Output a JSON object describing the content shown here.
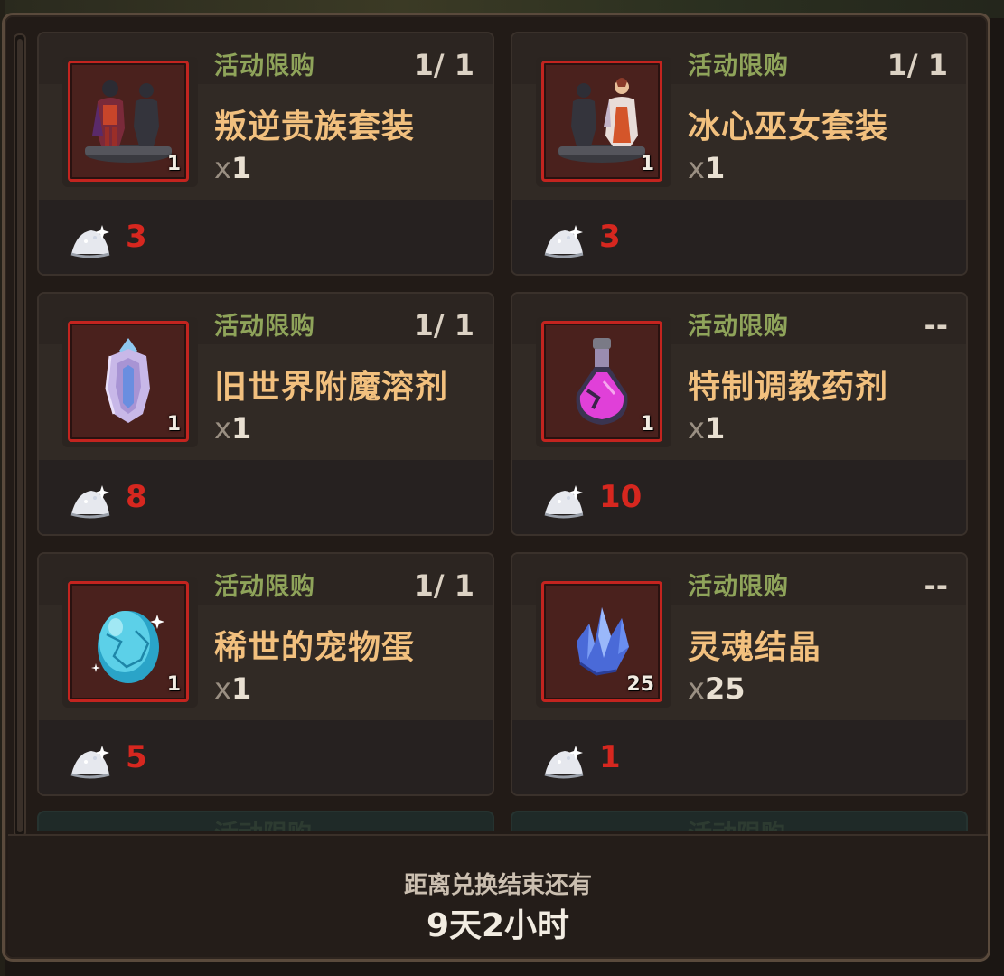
{
  "shop": {
    "items": [
      {
        "tag": "活动限购",
        "limit": "1/ 1",
        "name": "叛逆贵族套装",
        "qty_x": "x",
        "qty": "1",
        "icon_count": "1",
        "icon": "rebel-noble-outfit-icon",
        "price": "3"
      },
      {
        "tag": "活动限购",
        "limit": "1/ 1",
        "name": "冰心巫女套装",
        "qty_x": "x",
        "qty": "1",
        "icon_count": "1",
        "icon": "ice-heart-witch-outfit-icon",
        "price": "3"
      },
      {
        "tag": "活动限购",
        "limit": "1/ 1",
        "name": "旧世界附魔溶剂",
        "qty_x": "x",
        "qty": "1",
        "icon_count": "1",
        "icon": "enchant-solvent-icon",
        "price": "8"
      },
      {
        "tag": "活动限购",
        "limit": "--",
        "name": "特制调教药剂",
        "qty_x": "x",
        "qty": "1",
        "icon_count": "1",
        "icon": "potion-flask-icon",
        "price": "10"
      },
      {
        "tag": "活动限购",
        "limit": "1/ 1",
        "name": "稀世的宠物蛋",
        "qty_x": "x",
        "qty": "1",
        "icon_count": "1",
        "icon": "pet-egg-icon",
        "price": "5"
      },
      {
        "tag": "活动限购",
        "limit": "--",
        "name": "灵魂结晶",
        "qty_x": "x",
        "qty": "25",
        "icon_count": "25",
        "icon": "soul-crystal-icon",
        "price": "1"
      }
    ],
    "peek": [
      {
        "tag": "活动限购"
      },
      {
        "tag": "活动限购"
      }
    ],
    "currency_icon": "silver-powder-icon",
    "colors": {
      "tag": "#8fa45a",
      "name": "#f2c07e",
      "price": "#d6271f",
      "icon_border": "#c3241f"
    }
  },
  "footer": {
    "label": "距离兑换结束还有",
    "time": "9天2小时"
  }
}
